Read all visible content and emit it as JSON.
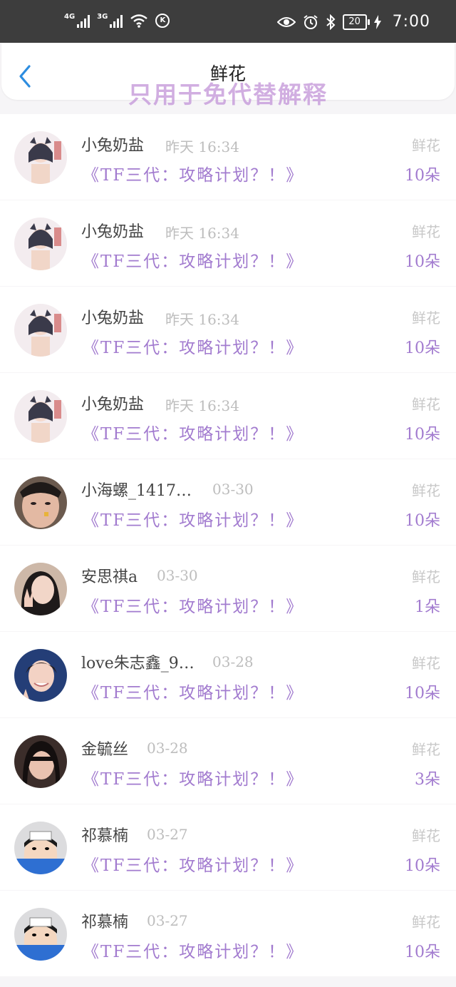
{
  "status_bar": {
    "net1": "4G",
    "net2": "3G",
    "k_badge": "K",
    "battery": "20",
    "time": "7:00"
  },
  "header": {
    "title": "鲜花"
  },
  "watermark": "只用于免代替解释",
  "rows": [
    {
      "name": "小兔奶盐",
      "date": "昨天 16:34",
      "work": "《TF三代：攻略计划？！》",
      "gift": "鲜花",
      "count": "10朵"
    },
    {
      "name": "小兔奶盐",
      "date": "昨天 16:34",
      "work": "《TF三代：攻略计划？！》",
      "gift": "鲜花",
      "count": "10朵"
    },
    {
      "name": "小兔奶盐",
      "date": "昨天 16:34",
      "work": "《TF三代：攻略计划？！》",
      "gift": "鲜花",
      "count": "10朵"
    },
    {
      "name": "小兔奶盐",
      "date": "昨天 16:34",
      "work": "《TF三代：攻略计划？！》",
      "gift": "鲜花",
      "count": "10朵"
    },
    {
      "name": "小海螺_1417…",
      "date": "03-30",
      "work": "《TF三代：攻略计划？！》",
      "gift": "鲜花",
      "count": "10朵"
    },
    {
      "name": "安思祺a",
      "date": "03-30",
      "work": "《TF三代：攻略计划？！》",
      "gift": "鲜花",
      "count": "1朵"
    },
    {
      "name": "love朱志鑫_9…",
      "date": "03-28",
      "work": "《TF三代：攻略计划？！》",
      "gift": "鲜花",
      "count": "10朵"
    },
    {
      "name": "金毓丝",
      "date": "03-28",
      "work": "《TF三代：攻略计划？！》",
      "gift": "鲜花",
      "count": "3朵"
    },
    {
      "name": "祁慕楠",
      "date": "03-27",
      "work": "《TF三代：攻略计划？！》",
      "gift": "鲜花",
      "count": "10朵"
    },
    {
      "name": "祁慕楠",
      "date": "03-27",
      "work": "《TF三代：攻略计划？！》",
      "gift": "鲜花",
      "count": "10朵"
    }
  ]
}
